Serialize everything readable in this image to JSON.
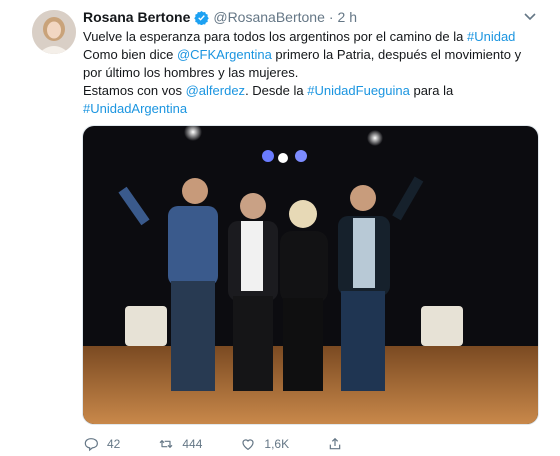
{
  "tweet": {
    "author_name": "Rosana Bertone",
    "handle": "@RosanaBertone",
    "separator": "·",
    "time": "2 h",
    "line1_text": "Vuelve la esperanza para todos los argentinos por el camino de la ",
    "line1_hashtag": "#Unidad",
    "line2_pre": "Como bien dice ",
    "line2_mention": "@CFKArgentina",
    "line2_post": " primero la Patria, después el movimiento y por último los hombres y las mujeres.",
    "line3_pre": "Estamos con vos ",
    "line3_mention": "@alferdez",
    "line3_mid": ". Desde la ",
    "line3_hashtag": "#UnidadFueguina",
    "line3_post": " para la",
    "line4_hashtag": "#UnidadArgentina"
  },
  "actions": {
    "reply_count": "42",
    "retweet_count": "444",
    "like_count": "1,6K"
  },
  "icons": {
    "verified": "verified-badge-icon",
    "menu": "chevron-down-icon",
    "reply": "reply-icon",
    "retweet": "retweet-icon",
    "like": "heart-icon",
    "share": "share-icon"
  },
  "colors": {
    "link": "#1b95e0",
    "muted": "#657786",
    "verified": "#1da1f2"
  }
}
